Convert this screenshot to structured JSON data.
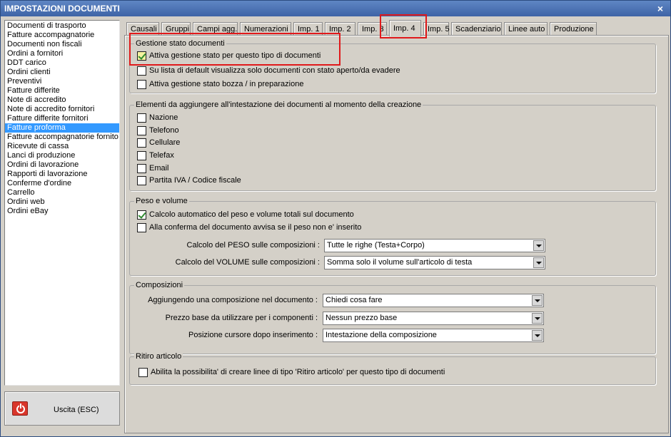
{
  "window": {
    "title": "IMPOSTAZIONI DOCUMENTI",
    "close_glyph": "×"
  },
  "sidebar": {
    "items": [
      "Documenti di trasporto",
      "Fatture accompagnatorie",
      "Documenti non fiscali",
      "Ordini a fornitori",
      "DDT carico",
      "Ordini clienti",
      "Preventivi",
      "Fatture differite",
      "Note di accredito",
      "Note di accredito fornitori",
      "Fatture differite fornitori",
      "Fatture proforma",
      "Fatture accompagnatorie fornito",
      "Ricevute di cassa",
      "Lanci di produzione",
      "Ordini di lavorazione",
      "Rapporti di lavorazione",
      "Conferme d'ordine",
      "Carrello",
      "Ordini web",
      "Ordini eBay"
    ],
    "selected_index": 11
  },
  "exit_button": {
    "label": "Uscita (ESC)",
    "icon": "power-icon"
  },
  "tabs": [
    "Causali",
    "Gruppi",
    "Campi agg.",
    "Numerazioni",
    "Imp. 1",
    "Imp. 2",
    "Imp. 3",
    "Imp. 4",
    "Imp. 5",
    "Scadenziario",
    "Linee auto",
    "Produzione"
  ],
  "active_tab": "Imp. 4",
  "highlight_color": "#e0191b",
  "groups": {
    "stato": {
      "legend": "Gestione stato documenti",
      "options": [
        {
          "label": "Attiva gestione stato per questo tipo di documenti",
          "checked": true
        },
        {
          "label": "Su lista di default visualizza solo documenti con stato aperto/da evadere",
          "checked": false
        },
        {
          "label": "Attiva gestione stato bozza / in preparazione",
          "checked": false
        }
      ]
    },
    "intestazione": {
      "legend": "Elementi da aggiungere all'intestazione dei documenti al momento della creazione",
      "options": [
        {
          "label": "Nazione",
          "checked": false
        },
        {
          "label": "Telefono",
          "checked": false
        },
        {
          "label": "Cellulare",
          "checked": false
        },
        {
          "label": "Telefax",
          "checked": false
        },
        {
          "label": "Email",
          "checked": false
        },
        {
          "label": "Partita IVA / Codice fiscale",
          "checked": false
        }
      ]
    },
    "peso": {
      "legend": "Peso e volume",
      "options": [
        {
          "label": "Calcolo automatico del peso e volume totali sul documento",
          "checked": true
        },
        {
          "label": "Alla conferma del documento avvisa se il peso non e' inserito",
          "checked": false
        }
      ],
      "fields": [
        {
          "label": "Calcolo del PESO sulle composizioni :",
          "value": "Tutte le righe (Testa+Corpo)"
        },
        {
          "label": "Calcolo del VOLUME sulle composizioni :",
          "value": "Somma solo il volume sull'articolo di testa"
        }
      ]
    },
    "composizioni": {
      "legend": "Composizioni",
      "fields": [
        {
          "label": "Aggiungendo una composizione nel documento :",
          "value": "Chiedi cosa fare"
        },
        {
          "label": "Prezzo base da utilizzare per i componenti :",
          "value": "Nessun prezzo base"
        },
        {
          "label": "Posizione cursore dopo inserimento :",
          "value": "Intestazione della composizione"
        }
      ]
    },
    "ritiro": {
      "legend": "Ritiro articolo",
      "options": [
        {
          "label": "Abilita la possibilita' di creare linee di tipo 'Ritiro articolo' per questo tipo di documenti",
          "checked": false
        }
      ]
    }
  }
}
